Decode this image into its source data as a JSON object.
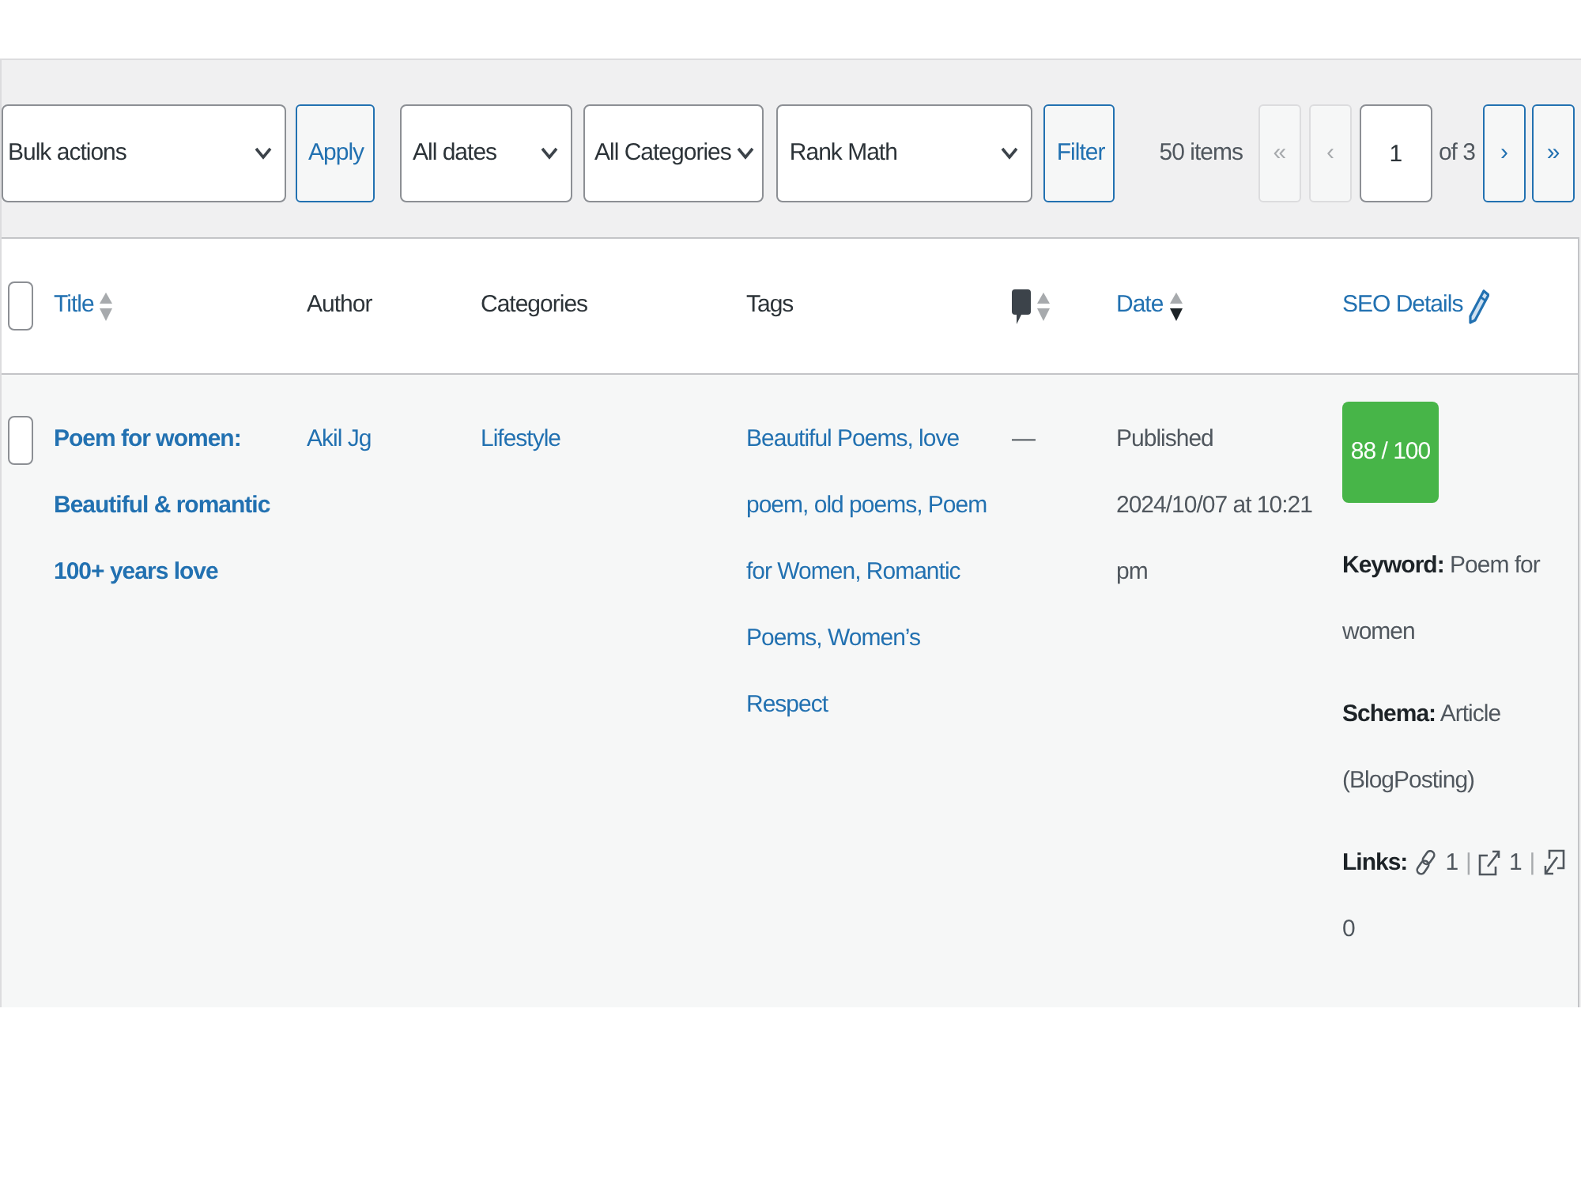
{
  "toolbar": {
    "bulk_actions": {
      "value": "Bulk actions"
    },
    "apply_button": "Apply",
    "filters": [
      {
        "value": "All dates"
      },
      {
        "value": "All Categories"
      },
      {
        "value": "Rank Math"
      }
    ],
    "filter_button": "Filter"
  },
  "pagination": {
    "count": "50 items",
    "back_buttons": [
      {
        "label": "«",
        "disabled": true
      },
      {
        "label": "‹",
        "disabled": true
      }
    ],
    "page": "1",
    "total": "of 3",
    "forward_buttons": [
      {
        "label": "›",
        "disabled": false
      },
      {
        "label": "»",
        "disabled": false
      }
    ]
  },
  "table": {
    "columns": [
      {
        "kind": "checkbox",
        "checked": false
      },
      {
        "kind": "text",
        "label": "Title",
        "sortable": true,
        "sorted": false
      },
      {
        "kind": "text",
        "label": "Author",
        "sortable": false
      },
      {
        "kind": "text",
        "label": "Categories",
        "sortable": false
      },
      {
        "kind": "text",
        "label": "Tags",
        "sortable": false
      },
      {
        "kind": "comments",
        "sortable": true,
        "sorted": false
      },
      {
        "kind": "text",
        "label": "Date",
        "sortable": true,
        "sorted": true
      },
      {
        "kind": "editable",
        "label": "SEO Details",
        "sortable": false
      }
    ],
    "rows": [
      {
        "checked": false,
        "title": "Poem for women: Beautiful & romantic 100+ years love",
        "author": "Akil Jg",
        "categories": "Lifestyle",
        "tags": "Beautiful Poems, love poem, old poems, Poem for Women, Romantic Poems, Women’s Respect",
        "comments": "—",
        "status": "Published",
        "date": "2024/10/07 at 10:21 pm",
        "seo": {
          "score": "88 / 100",
          "good_score": true,
          "keyword": "**Keyword:** Poem for women",
          "schema": "**Schema:** Article (BlogPosting)",
          "links_label": "Links:",
          "links": [
            {
              "kind": "internal",
              "count": "1",
              "separator": "|"
            },
            {
              "kind": "external",
              "count": "1",
              "separator": "|"
            },
            {
              "kind": "incoming",
              "count": "0"
            }
          ]
        }
      }
    ]
  }
}
